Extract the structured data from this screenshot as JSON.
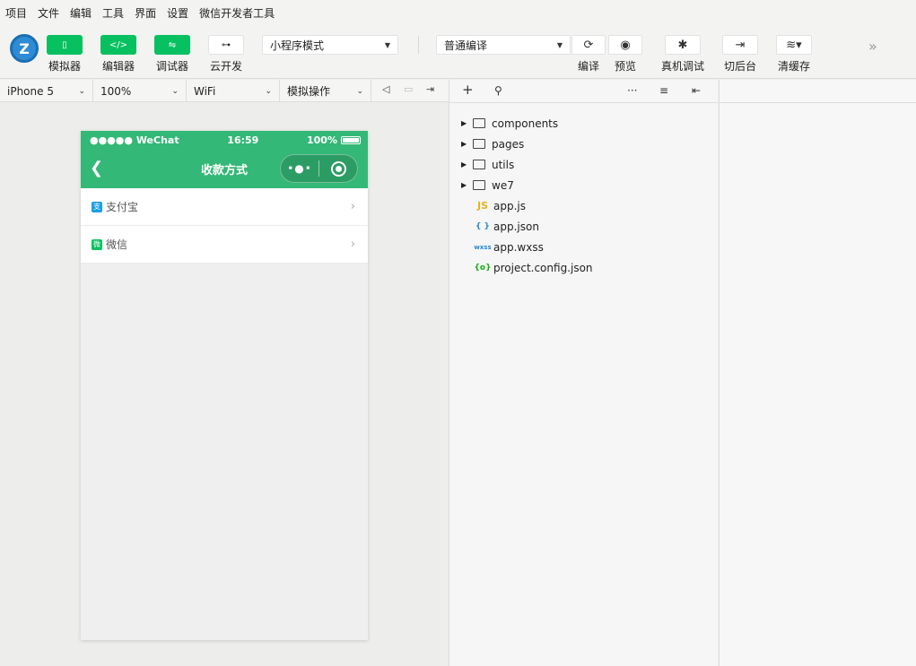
{
  "menu": [
    "项目",
    "文件",
    "编辑",
    "工具",
    "界面",
    "设置",
    "微信开发者工具"
  ],
  "toolbar": {
    "logo_text": "Z",
    "simulator_label": "模拟器",
    "editor_label": "编辑器",
    "debugger_label": "调试器",
    "cloud_label": "云开发",
    "mode_select": "小程序模式",
    "compile_select": "普通编译",
    "compile_label": "编译",
    "preview_label": "预览",
    "remote_debug_label": "真机调试",
    "background_label": "切后台",
    "clear_cache_label": "清缓存"
  },
  "subbar": {
    "device": "iPhone 5",
    "zoom": "100%",
    "network": "WiFi",
    "operation": "模拟操作"
  },
  "phone": {
    "status_left": "●●●●● WeChat",
    "status_time": "16:59",
    "status_battery": "100%",
    "nav_title": "收款方式",
    "capsule_dots": "•●•",
    "items": [
      {
        "label": "支付宝",
        "icon": "alipay-icon",
        "color": "#1a9ee8",
        "glyph": "支"
      },
      {
        "label": "微信",
        "icon": "wechat-icon",
        "color": "#07c160",
        "glyph": "微"
      }
    ]
  },
  "tree": {
    "folders": [
      "components",
      "pages",
      "utils",
      "we7"
    ],
    "files": [
      {
        "name": "app.js",
        "badge": "JS",
        "color": "#e6b422"
      },
      {
        "name": "app.json",
        "badge": "{ }",
        "color": "#2a8ad6"
      },
      {
        "name": "app.wxss",
        "badge": "wxss",
        "color": "#2a8ad6"
      },
      {
        "name": "project.config.json",
        "badge": "{o}",
        "color": "#1aad19"
      }
    ]
  },
  "colors": {
    "accent": "#07c160",
    "nav_green": "#34b877"
  }
}
